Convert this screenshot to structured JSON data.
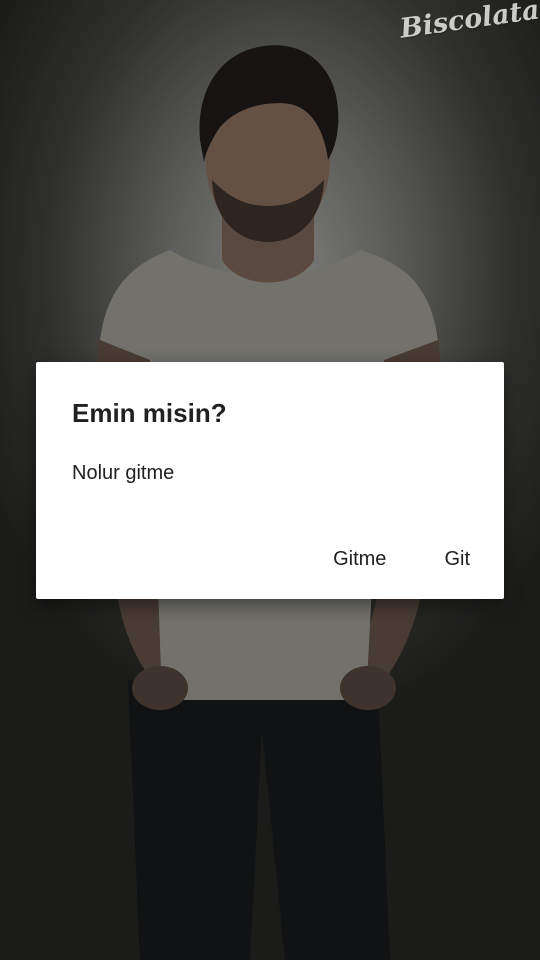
{
  "watermark": {
    "text": "Biscolata"
  },
  "dialog": {
    "title": "Emin misin?",
    "message": "Nolur gitme",
    "negative_label": "Gitme",
    "positive_label": "Git"
  },
  "colors": {
    "dialog_background": "#ffffff",
    "dialog_text": "#212121",
    "backdrop": "#2b2b29"
  }
}
